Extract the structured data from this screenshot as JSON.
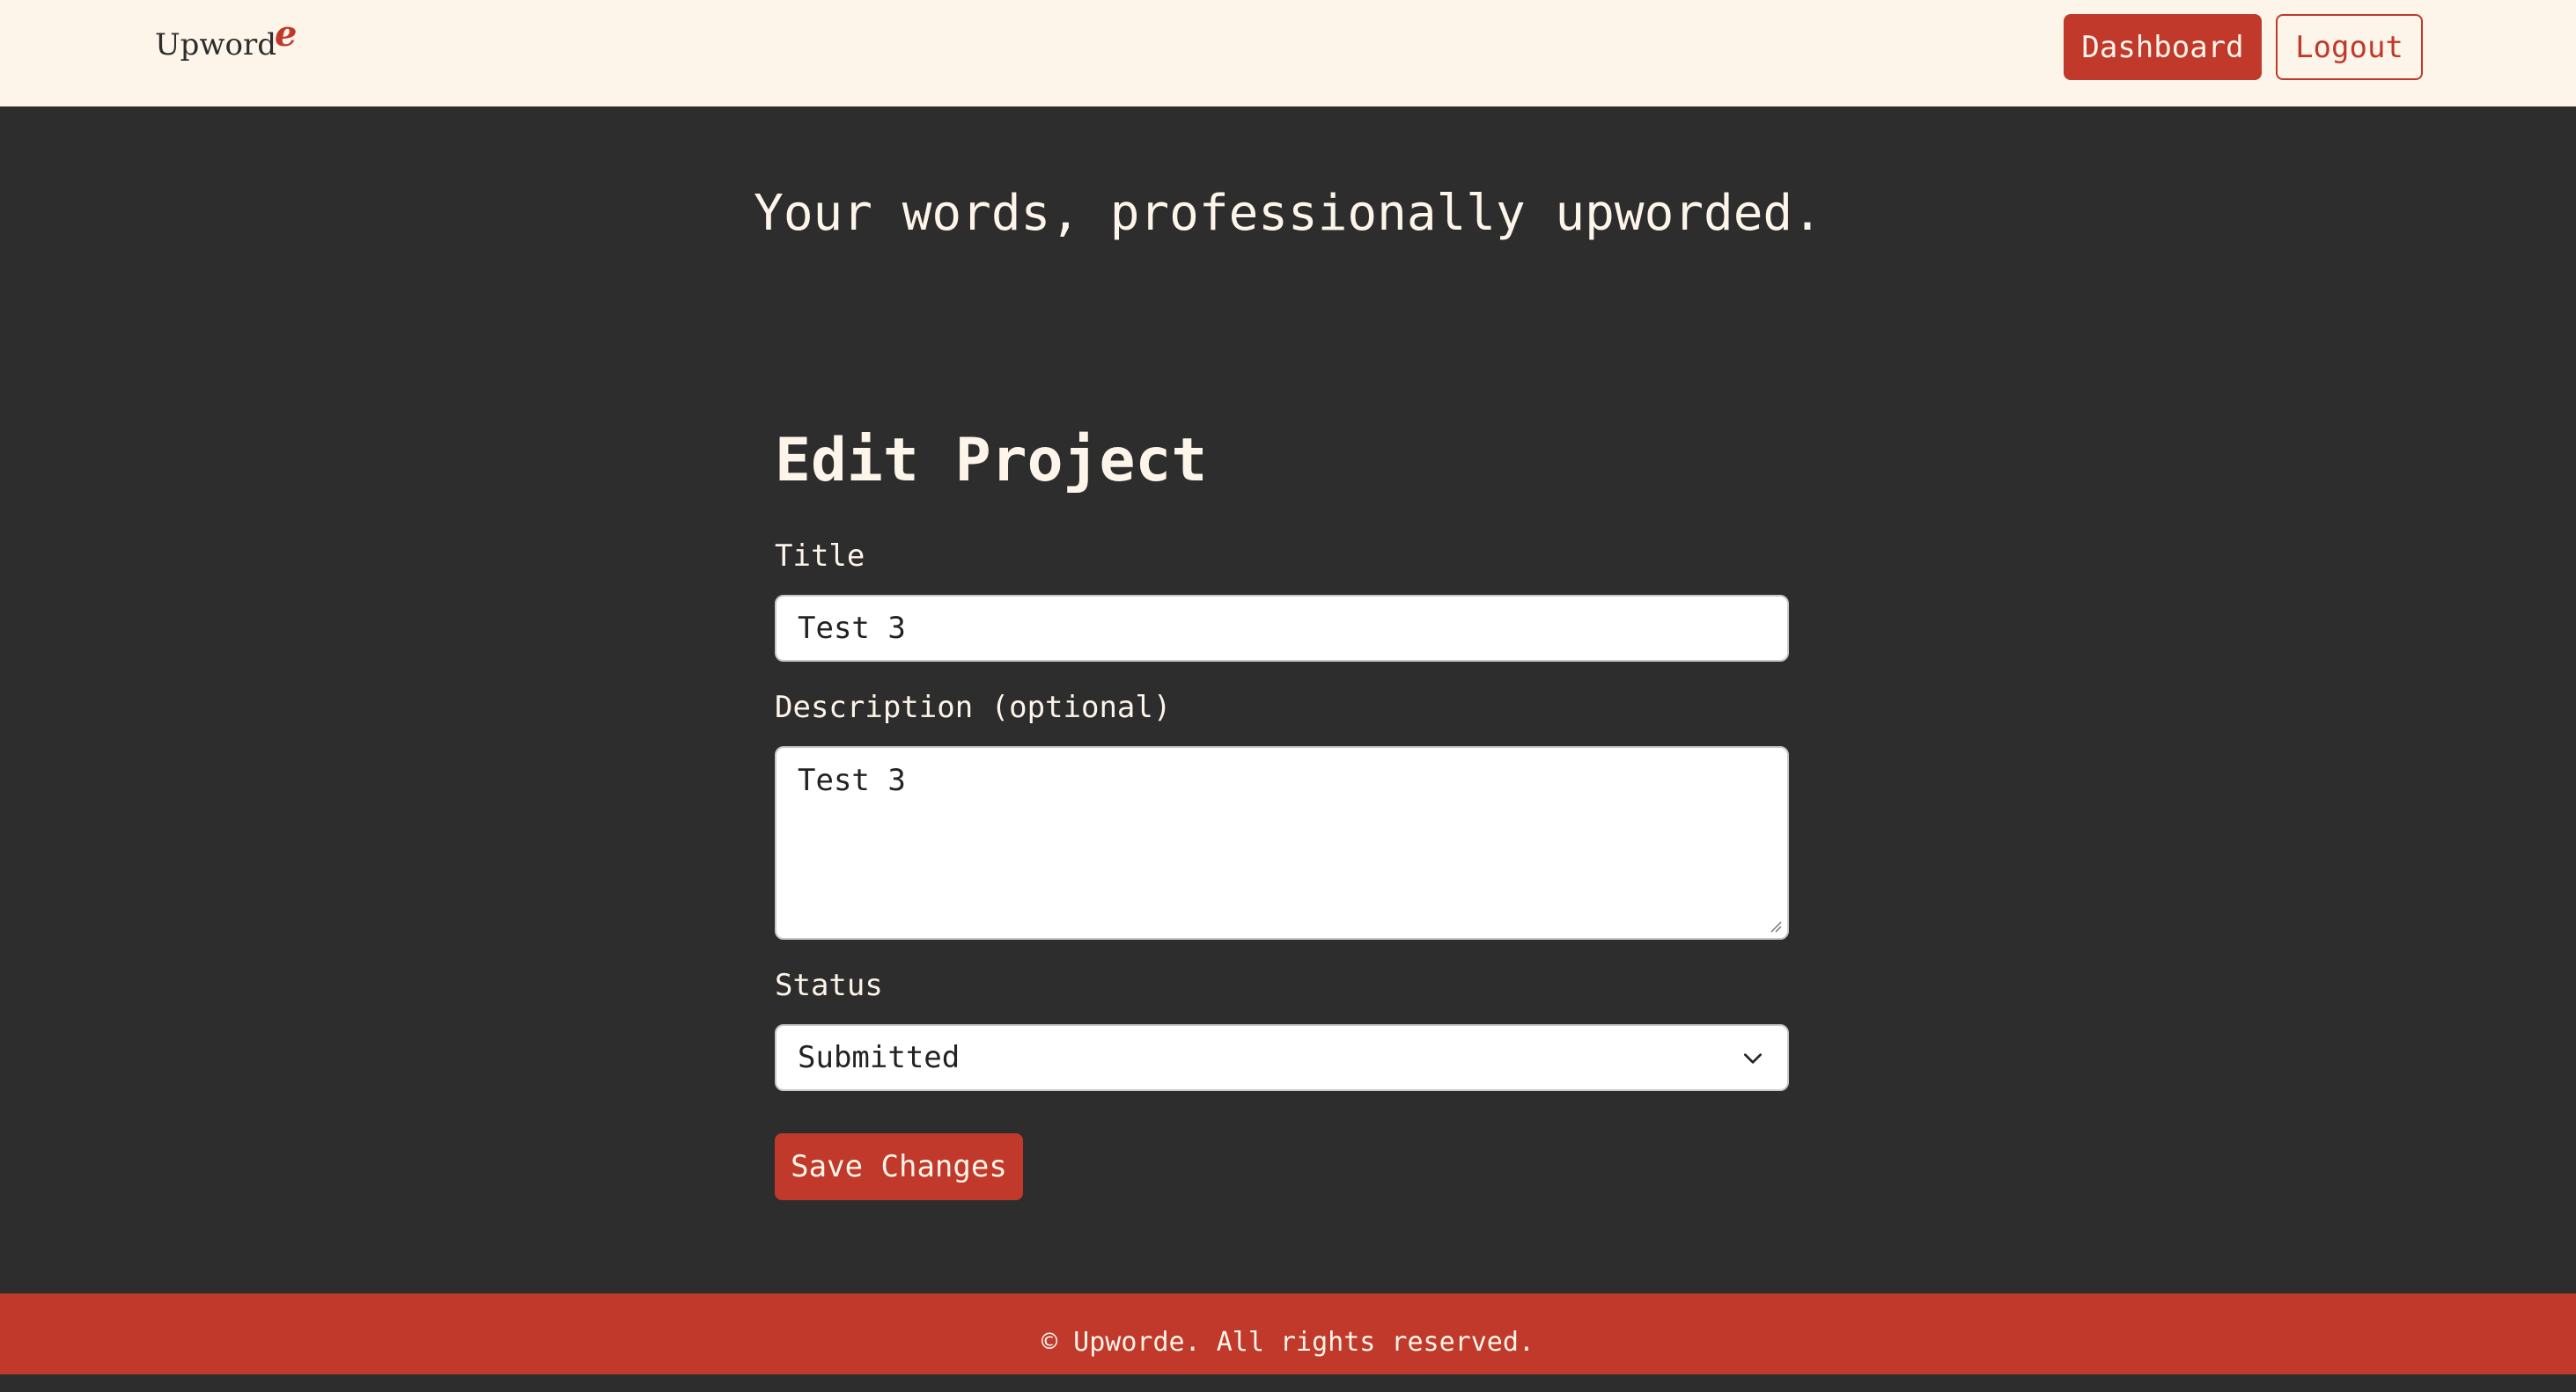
{
  "header": {
    "logo_main": "Upword",
    "logo_accent": "e",
    "dashboard_label": "Dashboard",
    "logout_label": "Logout"
  },
  "tagline": "Your words, professionally upworded.",
  "form": {
    "title": "Edit Project",
    "title_label": "Title",
    "title_value": "Test 3",
    "description_label": "Description (optional)",
    "description_value": "Test 3",
    "status_label": "Status",
    "status_value": "Submitted",
    "save_label": "Save Changes"
  },
  "footer": {
    "copyright": "© Upworde. All rights reserved."
  },
  "colors": {
    "accent": "#c0392b",
    "background": "#2d2d2d",
    "cream": "#fdf5e9"
  }
}
